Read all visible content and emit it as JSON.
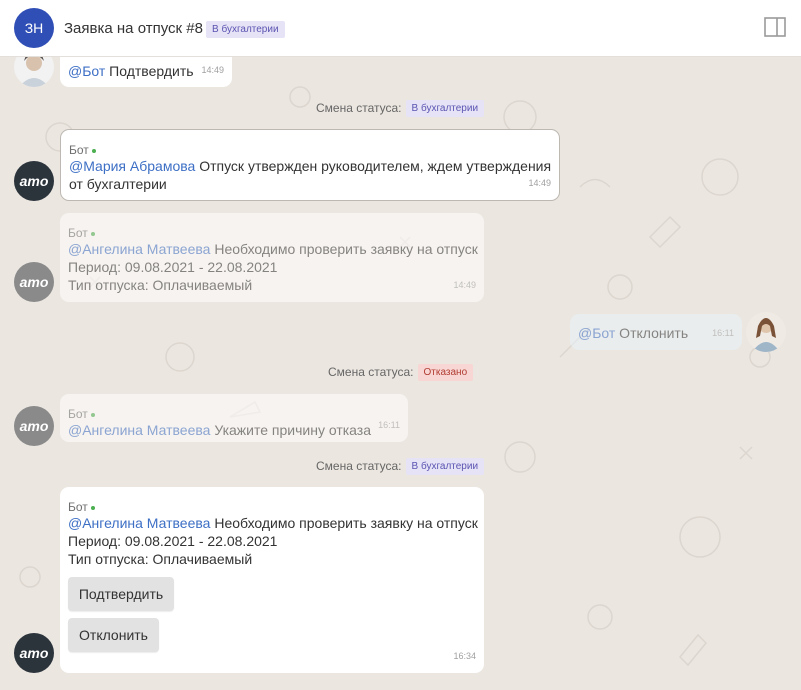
{
  "header": {
    "avatar_initials": "ЗН",
    "title": "Заявка на отпуск #8",
    "status_badge": "В бухгалтерии"
  },
  "messages": {
    "m1": {
      "mention": "@Бот",
      "text": " Подтвердить",
      "time": "14:49"
    },
    "status1": {
      "label": "Смена статуса:",
      "badge": "В бухгалтерии"
    },
    "m2": {
      "author": "Бот",
      "mention": "@Мария Абрамова",
      "text_line1": " Отпуск утвержден руководителем, ждем утверждения",
      "text_line2": "от бухгалтерии",
      "time": "14:49"
    },
    "m3": {
      "author": "Бот",
      "mention": "@Ангелина Матвеева",
      "text_line1": " Необходимо проверить заявку на отпуск",
      "line2": "Период: 09.08.2021 - 22.08.2021",
      "line3": "Тип отпуска: Оплачиваемый",
      "time": "14:49"
    },
    "m4": {
      "mention": "@Бот",
      "text": " Отклонить",
      "time": "16:11"
    },
    "status2": {
      "label": "Смена статуса:",
      "badge": "Отказано"
    },
    "m5": {
      "author": "Бот",
      "mention": "@Ангелина Матвеева",
      "text": " Укажите причину отказа",
      "time": "16:11"
    },
    "status3": {
      "label": "Смена статуса:",
      "badge": "В бухгалтерии"
    },
    "m6": {
      "author": "Бот",
      "mention": "@Ангелина Матвеева",
      "text_line1": " Необходимо проверить заявку на отпуск",
      "line2": "Период: 09.08.2021 - 22.08.2021",
      "line3": "Тип отпуска: Оплачиваемый",
      "confirm_button": "Подтвердить",
      "reject_button": "Отклонить",
      "time": "16:34"
    }
  },
  "amo_label": "amo",
  "colors": {
    "accent": "#3d6fc5",
    "status_purple": "#5b54b2",
    "status_red": "#b23c33",
    "online": "#4caf50"
  }
}
